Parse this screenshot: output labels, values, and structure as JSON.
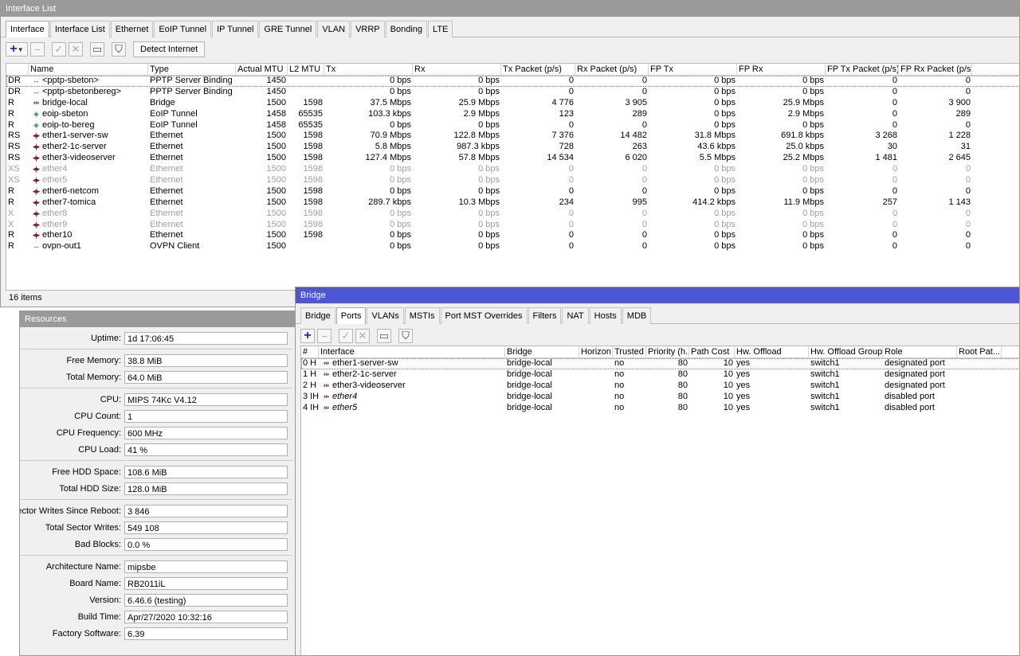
{
  "interface_window": {
    "title": "Interface List",
    "tabs": [
      "Interface",
      "Interface List",
      "Ethernet",
      "EoIP Tunnel",
      "IP Tunnel",
      "GRE Tunnel",
      "VLAN",
      "VRRP",
      "Bonding",
      "LTE"
    ],
    "detect_internet_label": "Detect Internet",
    "columns": [
      "",
      "Name",
      "Type",
      "Actual MTU",
      "L2 MTU",
      "Tx",
      "Rx",
      "Tx Packet (p/s)",
      "Rx Packet (p/s)",
      "FP Tx",
      "FP Rx",
      "FP Tx Packet (p/s)",
      "FP Rx Packet (p/s)"
    ],
    "rows": [
      {
        "flag": "DR",
        "icon": "pptp",
        "name": "<pptp-sbeton>",
        "type": "PPTP Server Binding",
        "mtu": "1450",
        "l2mtu": "",
        "tx": "0 bps",
        "rx": "0 bps",
        "txp": "0",
        "rxp": "0",
        "fptx": "0 bps",
        "fprx": "0 bps",
        "fptxp": "0",
        "fprxp": "0",
        "disabled": false
      },
      {
        "flag": "DR",
        "icon": "pptp",
        "name": "<pptp-sbetonbereg>",
        "type": "PPTP Server Binding",
        "mtu": "1450",
        "l2mtu": "",
        "tx": "0 bps",
        "rx": "0 bps",
        "txp": "0",
        "rxp": "0",
        "fptx": "0 bps",
        "fprx": "0 bps",
        "fptxp": "0",
        "fprxp": "0",
        "disabled": false
      },
      {
        "flag": "R",
        "icon": "bridge",
        "name": "bridge-local",
        "type": "Bridge",
        "mtu": "1500",
        "l2mtu": "1598",
        "tx": "37.5 Mbps",
        "rx": "25.9 Mbps",
        "txp": "4 776",
        "rxp": "3 905",
        "fptx": "0 bps",
        "fprx": "25.9 Mbps",
        "fptxp": "0",
        "fprxp": "3 900",
        "disabled": false
      },
      {
        "flag": "R",
        "icon": "eoip",
        "name": "eoip-sbeton",
        "type": "EoIP Tunnel",
        "mtu": "1458",
        "l2mtu": "65535",
        "tx": "103.3 kbps",
        "rx": "2.9 Mbps",
        "txp": "123",
        "rxp": "289",
        "fptx": "0 bps",
        "fprx": "2.9 Mbps",
        "fptxp": "0",
        "fprxp": "289",
        "disabled": false
      },
      {
        "flag": "R",
        "icon": "eoip",
        "name": "eoip-to-bereg",
        "type": "EoIP Tunnel",
        "mtu": "1458",
        "l2mtu": "65535",
        "tx": "0 bps",
        "rx": "0 bps",
        "txp": "0",
        "rxp": "0",
        "fptx": "0 bps",
        "fprx": "0 bps",
        "fptxp": "0",
        "fprxp": "0",
        "disabled": false
      },
      {
        "flag": "RS",
        "icon": "eth",
        "name": "ether1-server-sw",
        "type": "Ethernet",
        "mtu": "1500",
        "l2mtu": "1598",
        "tx": "70.9 Mbps",
        "rx": "122.8 Mbps",
        "txp": "7 376",
        "rxp": "14 482",
        "fptx": "31.8 Mbps",
        "fprx": "691.8 kbps",
        "fptxp": "3 268",
        "fprxp": "1 228",
        "disabled": false
      },
      {
        "flag": "RS",
        "icon": "eth",
        "name": "ether2-1c-server",
        "type": "Ethernet",
        "mtu": "1500",
        "l2mtu": "1598",
        "tx": "5.8 Mbps",
        "rx": "987.3 kbps",
        "txp": "728",
        "rxp": "263",
        "fptx": "43.6 kbps",
        "fprx": "25.0 kbps",
        "fptxp": "30",
        "fprxp": "31",
        "disabled": false
      },
      {
        "flag": "RS",
        "icon": "eth",
        "name": "ether3-videoserver",
        "type": "Ethernet",
        "mtu": "1500",
        "l2mtu": "1598",
        "tx": "127.4 Mbps",
        "rx": "57.8 Mbps",
        "txp": "14 534",
        "rxp": "6 020",
        "fptx": "5.5 Mbps",
        "fprx": "25.2 Mbps",
        "fptxp": "1 481",
        "fprxp": "2 645",
        "disabled": false
      },
      {
        "flag": "XS",
        "icon": "eth",
        "name": "ether4",
        "type": "Ethernet",
        "mtu": "1500",
        "l2mtu": "1598",
        "tx": "0 bps",
        "rx": "0 bps",
        "txp": "0",
        "rxp": "0",
        "fptx": "0 bps",
        "fprx": "0 bps",
        "fptxp": "0",
        "fprxp": "0",
        "disabled": true
      },
      {
        "flag": "XS",
        "icon": "eth",
        "name": "ether5",
        "type": "Ethernet",
        "mtu": "1500",
        "l2mtu": "1598",
        "tx": "0 bps",
        "rx": "0 bps",
        "txp": "0",
        "rxp": "0",
        "fptx": "0 bps",
        "fprx": "0 bps",
        "fptxp": "0",
        "fprxp": "0",
        "disabled": true
      },
      {
        "flag": "R",
        "icon": "eth",
        "name": "ether6-netcom",
        "type": "Ethernet",
        "mtu": "1500",
        "l2mtu": "1598",
        "tx": "0 bps",
        "rx": "0 bps",
        "txp": "0",
        "rxp": "0",
        "fptx": "0 bps",
        "fprx": "0 bps",
        "fptxp": "0",
        "fprxp": "0",
        "disabled": false
      },
      {
        "flag": "R",
        "icon": "eth",
        "name": "ether7-tomica",
        "type": "Ethernet",
        "mtu": "1500",
        "l2mtu": "1598",
        "tx": "289.7 kbps",
        "rx": "10.3 Mbps",
        "txp": "234",
        "rxp": "995",
        "fptx": "414.2 kbps",
        "fprx": "11.9 Mbps",
        "fptxp": "257",
        "fprxp": "1 143",
        "disabled": false
      },
      {
        "flag": "X",
        "icon": "eth",
        "name": "ether8",
        "type": "Ethernet",
        "mtu": "1500",
        "l2mtu": "1598",
        "tx": "0 bps",
        "rx": "0 bps",
        "txp": "0",
        "rxp": "0",
        "fptx": "0 bps",
        "fprx": "0 bps",
        "fptxp": "0",
        "fprxp": "0",
        "disabled": true
      },
      {
        "flag": "X",
        "icon": "eth",
        "name": "ether9",
        "type": "Ethernet",
        "mtu": "1500",
        "l2mtu": "1598",
        "tx": "0 bps",
        "rx": "0 bps",
        "txp": "0",
        "rxp": "0",
        "fptx": "0 bps",
        "fprx": "0 bps",
        "fptxp": "0",
        "fprxp": "0",
        "disabled": true
      },
      {
        "flag": "R",
        "icon": "eth",
        "name": "ether10",
        "type": "Ethernet",
        "mtu": "1500",
        "l2mtu": "1598",
        "tx": "0 bps",
        "rx": "0 bps",
        "txp": "0",
        "rxp": "0",
        "fptx": "0 bps",
        "fprx": "0 bps",
        "fptxp": "0",
        "fprxp": "0",
        "disabled": false
      },
      {
        "flag": "R",
        "icon": "pptp",
        "name": "ovpn-out1",
        "type": "OVPN Client",
        "mtu": "1500",
        "l2mtu": "",
        "tx": "0 bps",
        "rx": "0 bps",
        "txp": "0",
        "rxp": "0",
        "fptx": "0 bps",
        "fprx": "0 bps",
        "fptxp": "0",
        "fprxp": "0",
        "disabled": false
      }
    ],
    "status": "16 items"
  },
  "resources_window": {
    "title": "Resources",
    "groups": [
      [
        {
          "label": "Uptime:",
          "value": "1d 17:06:45"
        }
      ],
      [
        {
          "label": "Free Memory:",
          "value": "38.8 MiB"
        },
        {
          "label": "Total Memory:",
          "value": "64.0 MiB"
        }
      ],
      [
        {
          "label": "CPU:",
          "value": "MIPS 74Kc V4.12"
        },
        {
          "label": "CPU Count:",
          "value": "1"
        },
        {
          "label": "CPU Frequency:",
          "value": "600 MHz"
        },
        {
          "label": "CPU Load:",
          "value": "41 %"
        }
      ],
      [
        {
          "label": "Free HDD Space:",
          "value": "108.6 MiB"
        },
        {
          "label": "Total HDD Size:",
          "value": "128.0 MiB"
        }
      ],
      [
        {
          "label": "Sector Writes Since Reboot:",
          "value": "3 846"
        },
        {
          "label": "Total Sector Writes:",
          "value": "549 108"
        },
        {
          "label": "Bad Blocks:",
          "value": "0.0 %"
        }
      ],
      [
        {
          "label": "Architecture Name:",
          "value": "mipsbe"
        },
        {
          "label": "Board Name:",
          "value": "RB2011iL"
        },
        {
          "label": "Version:",
          "value": "6.46.6 (testing)"
        },
        {
          "label": "Build Time:",
          "value": "Apr/27/2020 10:32:16"
        },
        {
          "label": "Factory Software:",
          "value": "6.39"
        }
      ]
    ]
  },
  "bridge_window": {
    "title": "Bridge",
    "tabs": [
      "Bridge",
      "Ports",
      "VLANs",
      "MSTIs",
      "Port MST Overrides",
      "Filters",
      "NAT",
      "Hosts",
      "MDB"
    ],
    "columns": [
      "#",
      "Interface",
      "Bridge",
      "Horizon",
      "Trusted",
      "Priority (h...",
      "Path Cost",
      "Hw. Offload",
      "Hw. Offload Group",
      "Role",
      "Root Pat..."
    ],
    "rows": [
      {
        "idx": "0",
        "flags": "H",
        "iface": "ether1-server-sw",
        "bridge": "bridge-local",
        "horizon": "",
        "trusted": "no",
        "priority": "80",
        "cost": "10",
        "hw": "yes",
        "group": "switch1",
        "role": "designated port",
        "root": "",
        "italic": false
      },
      {
        "idx": "1",
        "flags": "H",
        "iface": "ether2-1c-server",
        "bridge": "bridge-local",
        "horizon": "",
        "trusted": "no",
        "priority": "80",
        "cost": "10",
        "hw": "yes",
        "group": "switch1",
        "role": "designated port",
        "root": "",
        "italic": false
      },
      {
        "idx": "2",
        "flags": "H",
        "iface": "ether3-videoserver",
        "bridge": "bridge-local",
        "horizon": "",
        "trusted": "no",
        "priority": "80",
        "cost": "10",
        "hw": "yes",
        "group": "switch1",
        "role": "designated port",
        "root": "",
        "italic": false
      },
      {
        "idx": "3",
        "flags": "IH",
        "iface": "ether4",
        "bridge": "bridge-local",
        "horizon": "",
        "trusted": "no",
        "priority": "80",
        "cost": "10",
        "hw": "yes",
        "group": "switch1",
        "role": "disabled port",
        "root": "",
        "italic": true
      },
      {
        "idx": "4",
        "flags": "IH",
        "iface": "ether5",
        "bridge": "bridge-local",
        "horizon": "",
        "trusted": "no",
        "priority": "80",
        "cost": "10",
        "hw": "yes",
        "group": "switch1",
        "role": "disabled port",
        "root": "",
        "italic": true
      }
    ]
  },
  "icons": {
    "add": "plus-icon",
    "remove": "minus-icon",
    "enable": "check-icon",
    "disable": "x-icon",
    "comment": "comment-icon",
    "filter": "filter-icon"
  },
  "colors": {
    "bridge_titlebar": "#4c56d8",
    "inactive_titlebar": "#9a9a9a",
    "disabled_text": "#a0a0a0"
  }
}
